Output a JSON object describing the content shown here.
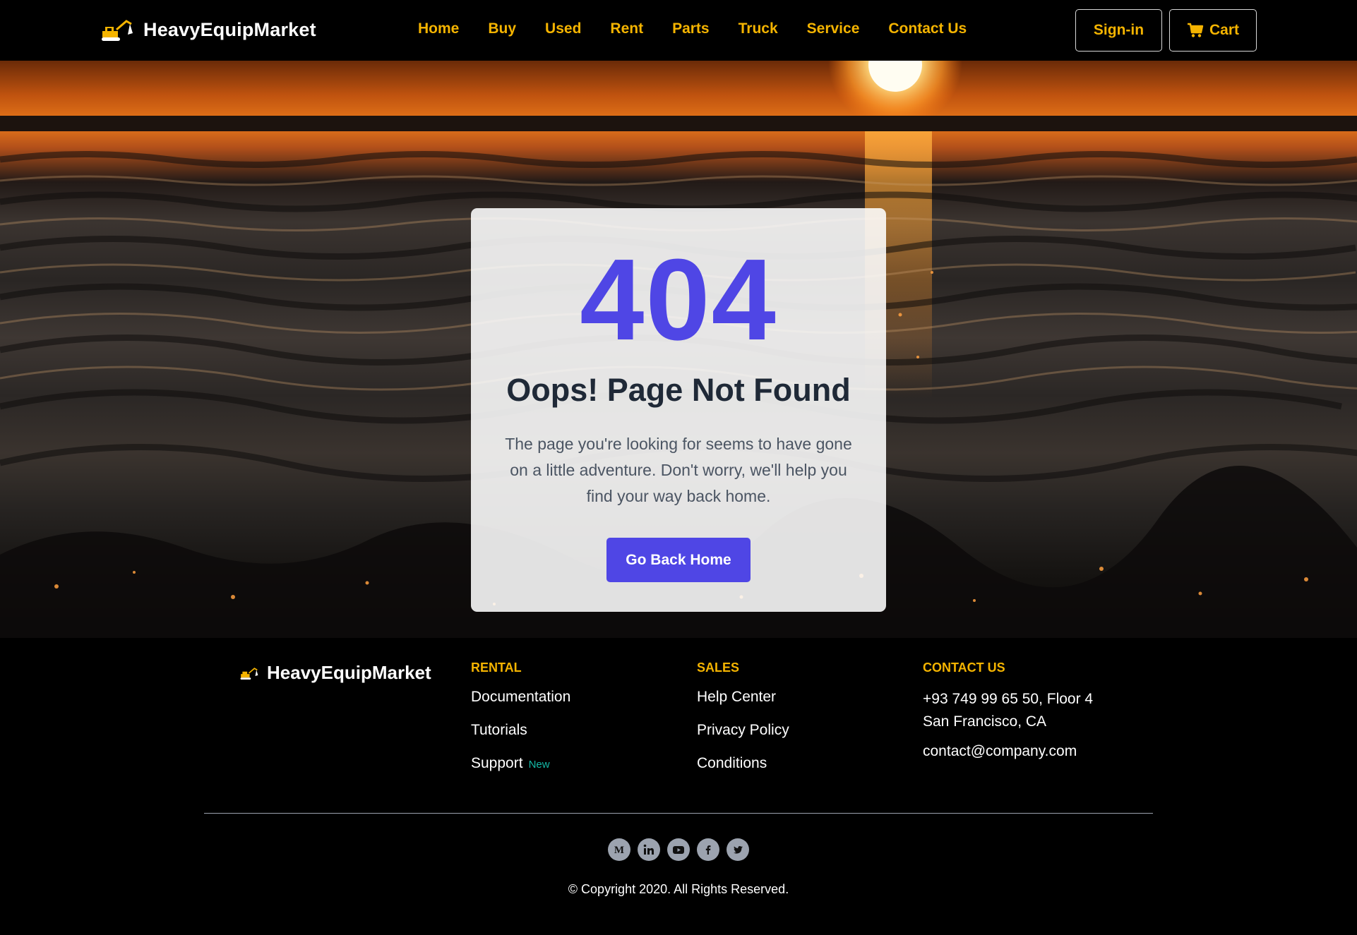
{
  "header": {
    "brand": "HeavyEquipMarket",
    "nav": [
      "Home",
      "Buy",
      "Used",
      "Rent",
      "Parts",
      "Truck",
      "Service",
      "Contact Us"
    ],
    "signin_label": "Sign-in",
    "cart_label": "Cart",
    "accent_color": "#f5b400"
  },
  "error": {
    "code": "404",
    "title": "Oops! Page Not Found",
    "message": "The page you're looking for seems to have gone on a little adventure. Don't worry, we'll help you find your way back home.",
    "button_label": "Go Back Home",
    "primary_color": "#4f46e5"
  },
  "footer": {
    "brand": "HeavyEquipMarket",
    "rental": {
      "heading": "RENTAL",
      "links": [
        "Documentation",
        "Tutorials",
        "Support"
      ],
      "badge": "New"
    },
    "sales": {
      "heading": "SALES",
      "links": [
        "Help Center",
        "Privacy Policy",
        "Conditions"
      ]
    },
    "contact": {
      "heading": "CONTACT US",
      "address_line1": "+93 749 99 65 50, Floor 4",
      "address_line2": "San Francisco, CA",
      "email": "contact@company.com"
    },
    "socials": [
      "medium-icon",
      "linkedin-icon",
      "youtube-icon",
      "facebook-icon",
      "twitter-icon"
    ],
    "copyright": "© Copyright 2020. All Rights Reserved."
  }
}
